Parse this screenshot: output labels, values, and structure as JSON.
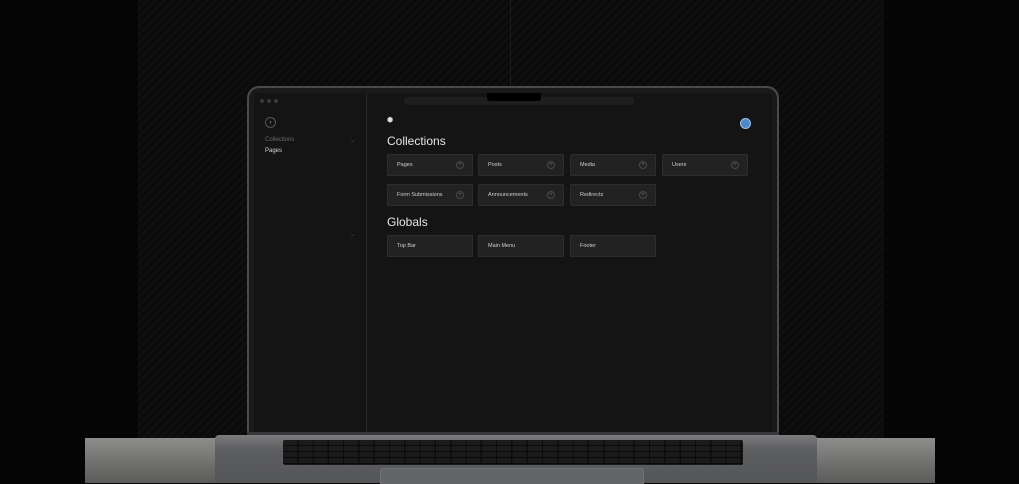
{
  "sidebar": {
    "group_label": "Collections",
    "group_chevron": "⌄",
    "active_item": "Pages",
    "second_chevron": "⌄",
    "back_icon": "chevron-left-icon",
    "back_glyph": "‹"
  },
  "header": {
    "logo_icon": "payload-logo-icon",
    "logo_glyph": "⬢",
    "avatar_icon": "user-avatar-icon"
  },
  "collections": {
    "title": "Collections",
    "items": [
      {
        "label": "Pages"
      },
      {
        "label": "Posts"
      },
      {
        "label": "Media"
      },
      {
        "label": "Users"
      },
      {
        "label": "Form Submissions"
      },
      {
        "label": "Announcements"
      },
      {
        "label": "Redirects"
      }
    ]
  },
  "globals": {
    "title": "Globals",
    "items": [
      {
        "label": "Top Bar"
      },
      {
        "label": "Main Menu"
      },
      {
        "label": "Footer"
      }
    ]
  },
  "icons": {
    "add": "plus-icon",
    "add_glyph": "+"
  },
  "colors": {
    "background": "#141414",
    "card": "#222222",
    "text": "#e6e6e6",
    "accent": "#4d8ac4"
  }
}
